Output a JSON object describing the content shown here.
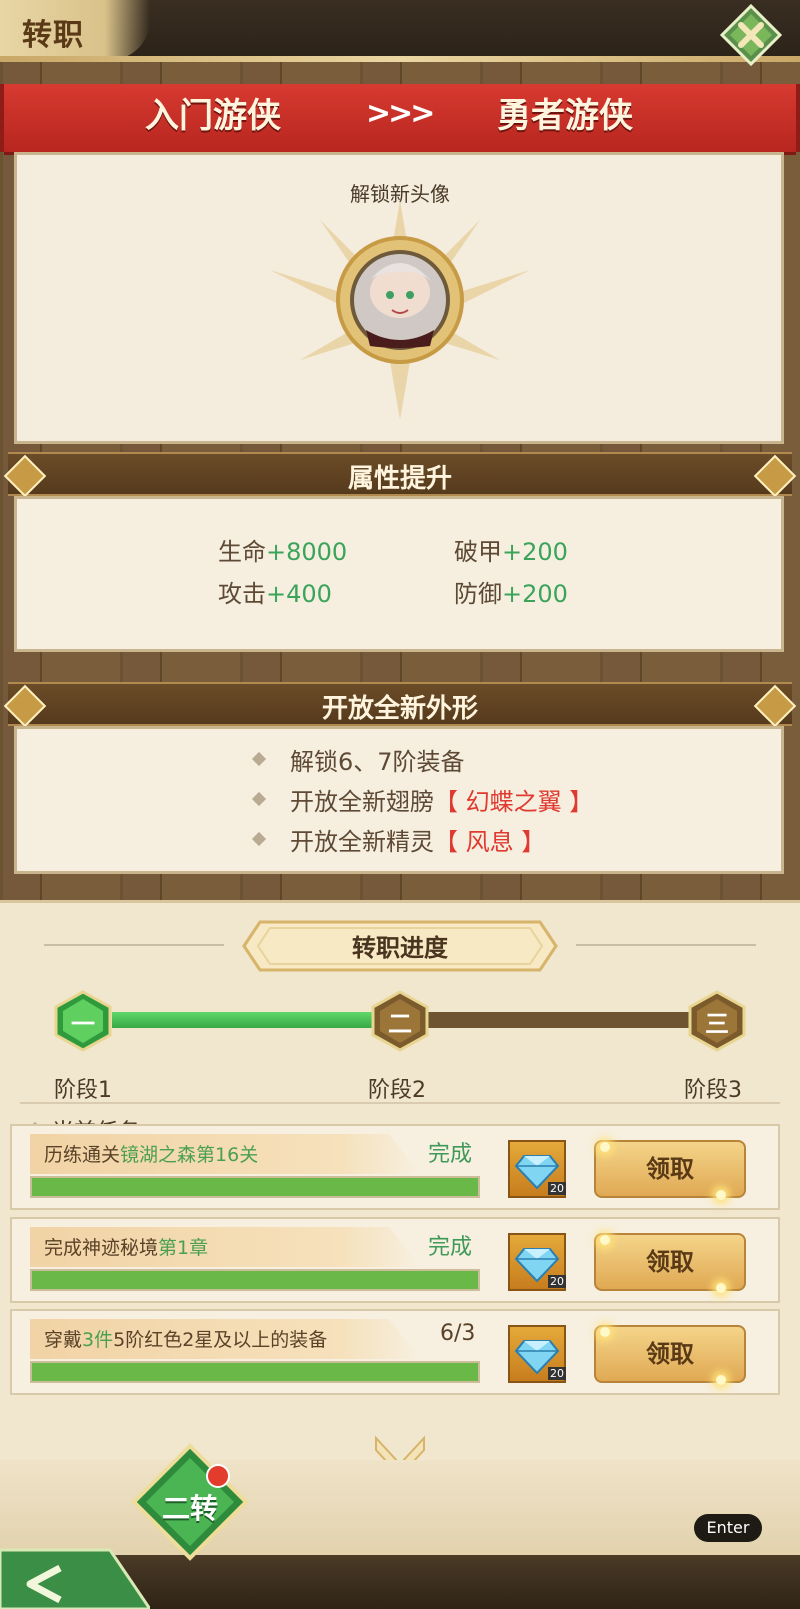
{
  "header": {
    "title": "转职"
  },
  "ribbon": {
    "from_class": "入门游侠",
    "arrows": ">>>",
    "to_class": "勇者游侠"
  },
  "avatar_section": {
    "label": "解锁新头像"
  },
  "attributes": {
    "title": "属性提升",
    "items": [
      {
        "name": "生命",
        "value": "+8000"
      },
      {
        "name": "破甲",
        "value": "+200"
      },
      {
        "name": "攻击",
        "value": "+400"
      },
      {
        "name": "防御",
        "value": "+200"
      }
    ]
  },
  "appearance": {
    "title": "开放全新外形",
    "items": [
      {
        "text": "解锁6、7阶装备",
        "highlight": ""
      },
      {
        "text": "开放全新翅膀",
        "highlight": "【 幻蝶之翼 】"
      },
      {
        "text": "开放全新精灵",
        "highlight": "【 风息 】"
      }
    ]
  },
  "progress": {
    "title": "转职进度",
    "stages": [
      {
        "numeral": "一",
        "label": "阶段1",
        "state": "done"
      },
      {
        "numeral": "二",
        "label": "阶段2",
        "state": "current"
      },
      {
        "numeral": "三",
        "label": "阶段3",
        "state": "locked"
      }
    ],
    "fill_fraction": 0.5,
    "current_task_label": "当前任务:"
  },
  "tasks": [
    {
      "prefix": "历练通关",
      "highlight": "镜湖之森第16关",
      "suffix": "",
      "status": "完成",
      "progress_fraction": 1.0,
      "reward_qty": "20",
      "button": "领取"
    },
    {
      "prefix": "完成神迹秘境",
      "highlight": "第1章",
      "suffix": "",
      "status": "完成",
      "progress_fraction": 1.0,
      "reward_qty": "20",
      "button": "领取"
    },
    {
      "prefix": "穿戴",
      "highlight": "3件",
      "suffix": "5阶红色2星及以上的装备",
      "status": "6/3",
      "progress_fraction": 1.0,
      "reward_qty": "20",
      "button": "领取"
    }
  ],
  "bottom": {
    "rank_badge": "二转",
    "enter_label": "Enter"
  },
  "colors": {
    "ribbon_red": "#c8302a",
    "progress_green": "#4cc25a",
    "text_green": "#3aa45a",
    "highlight_red": "#e0392f"
  }
}
